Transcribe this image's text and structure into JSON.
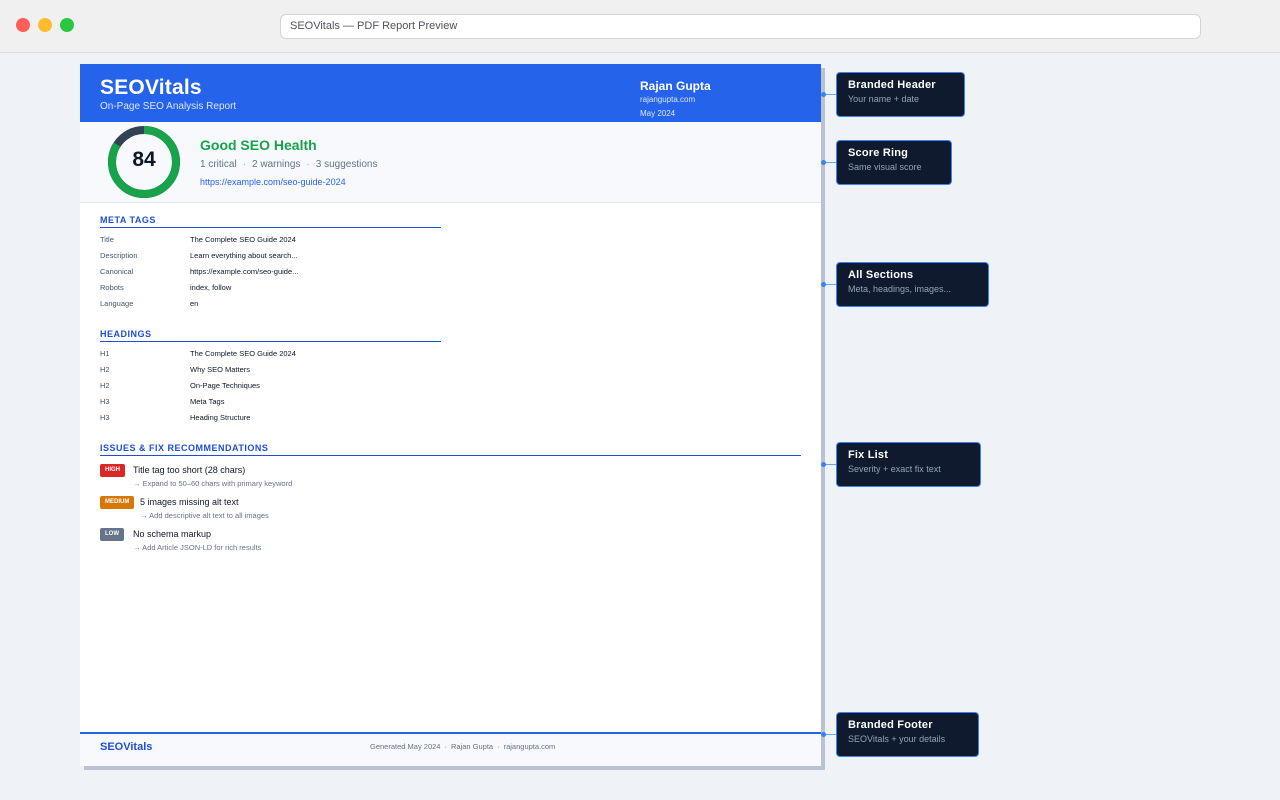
{
  "browser": {
    "address": "SEOVitals — PDF Report Preview"
  },
  "report": {
    "brand": "SEOVitals",
    "subtitle": "On-Page SEO Analysis Report",
    "author": {
      "name": "Rajan Gupta",
      "site": "rajangupta.com",
      "date": "May 2024"
    },
    "score": {
      "value": "84",
      "fraction": 0.84,
      "status": "Good SEO Health",
      "critical": "1 critical",
      "warnings": "2 warnings",
      "suggestions": "3 suggestions",
      "url": "https://example.com/seo-guide-2024",
      "ring_color": "#16a34a",
      "track_color": "#334155"
    },
    "meta_tags": {
      "title": "META TAGS",
      "rows": [
        {
          "key": "Title",
          "value": "The Complete SEO Guide 2024"
        },
        {
          "key": "Description",
          "value": "Learn everything about search..."
        },
        {
          "key": "Canonical",
          "value": "https://example.com/seo-guide..."
        },
        {
          "key": "Robots",
          "value": "index, follow"
        },
        {
          "key": "Language",
          "value": "en"
        }
      ]
    },
    "headings": {
      "title": "HEADINGS",
      "rows": [
        {
          "key": "H1",
          "value": "The Complete SEO Guide 2024"
        },
        {
          "key": "H2",
          "value": "Why SEO Matters"
        },
        {
          "key": "H2",
          "value": "On-Page Techniques"
        },
        {
          "key": "H3",
          "value": "Meta Tags"
        },
        {
          "key": "H3",
          "value": "Heading Structure"
        }
      ]
    },
    "issues": {
      "title": "ISSUES & FIX RECOMMENDATIONS",
      "items": [
        {
          "severity": "HIGH",
          "color": "#dc2626",
          "title": "Title tag too short (28 chars)",
          "fix": "→ Expand to 50–60 chars with primary keyword"
        },
        {
          "severity": "MEDIUM",
          "color": "#d97706",
          "title": "5 images missing alt text",
          "fix": "→ Add descriptive alt text to all images"
        },
        {
          "severity": "LOW",
          "color": "#64748b",
          "title": "No schema markup",
          "fix": "→ Add Article JSON-LD for rich results"
        }
      ]
    },
    "footer": {
      "brand": "SEOVitals",
      "generated": "Generated May 2024",
      "author": "Rajan Gupta",
      "site": "rajangupta.com"
    }
  },
  "callouts": [
    {
      "title": "Branded Header",
      "subtitle": "Your name + date"
    },
    {
      "title": "Score Ring",
      "subtitle": "Same visual score"
    },
    {
      "title": "All Sections",
      "subtitle": "Meta, headings, images..."
    },
    {
      "title": "Fix List",
      "subtitle": "Severity + exact fix text"
    },
    {
      "title": "Branded Footer",
      "subtitle": "SEOVitals + your details"
    }
  ]
}
